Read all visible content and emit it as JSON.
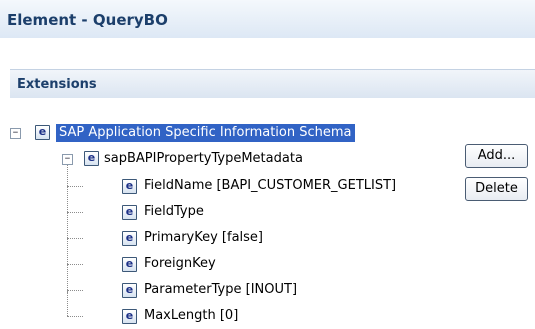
{
  "header": {
    "title": "Element - QueryBO"
  },
  "section": {
    "title": "Extensions"
  },
  "tree": {
    "root": {
      "label": "SAP Application Specific Information Schema",
      "toggle": "−",
      "child": {
        "label": "sapBAPIPropertyTypeMetadata",
        "toggle": "−",
        "items": [
          {
            "label": "FieldName [BAPI_CUSTOMER_GETLIST]"
          },
          {
            "label": "FieldType"
          },
          {
            "label": "PrimaryKey [false]"
          },
          {
            "label": "ForeignKey"
          },
          {
            "label": "ParameterType [INOUT]"
          },
          {
            "label": "MaxLength [0]"
          }
        ]
      }
    },
    "icon_glyph": "e"
  },
  "buttons": {
    "add_label": "Add...",
    "delete_label": "Delete"
  }
}
